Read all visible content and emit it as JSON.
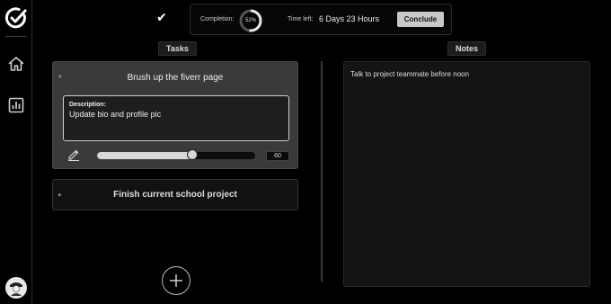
{
  "sidebar": {
    "logo_icon": "check-circle-logo-icon",
    "items": [
      {
        "name": "home",
        "icon": "home-icon"
      },
      {
        "name": "stats",
        "icon": "bar-chart-icon"
      }
    ],
    "avatar_icon": "avatar-icon"
  },
  "topbar": {
    "check_glyph": "✔",
    "completion_label": "Completion:",
    "completion_value": "52%",
    "completion_fraction": 0.52,
    "time_left_label": "Time left:",
    "time_left_value": "6 Days 23 Hours",
    "conclude_label": "Conclude"
  },
  "tasks": {
    "header": "Tasks",
    "items": [
      {
        "title": "Brush up the fiverr page",
        "expanded": true,
        "description_label": "Description:",
        "description": "Update bio and profile pic",
        "progress": 60,
        "progress_display": "60"
      },
      {
        "title": "Finish current school project",
        "expanded": false
      }
    ]
  },
  "notes": {
    "header": "Notes",
    "text": "Talk to project teammate before noon"
  },
  "colors": {
    "background": "#000000",
    "card_expanded": "#3a3a3a",
    "card_collapsed": "#111111",
    "conclude_button": "#c8c8c8"
  }
}
